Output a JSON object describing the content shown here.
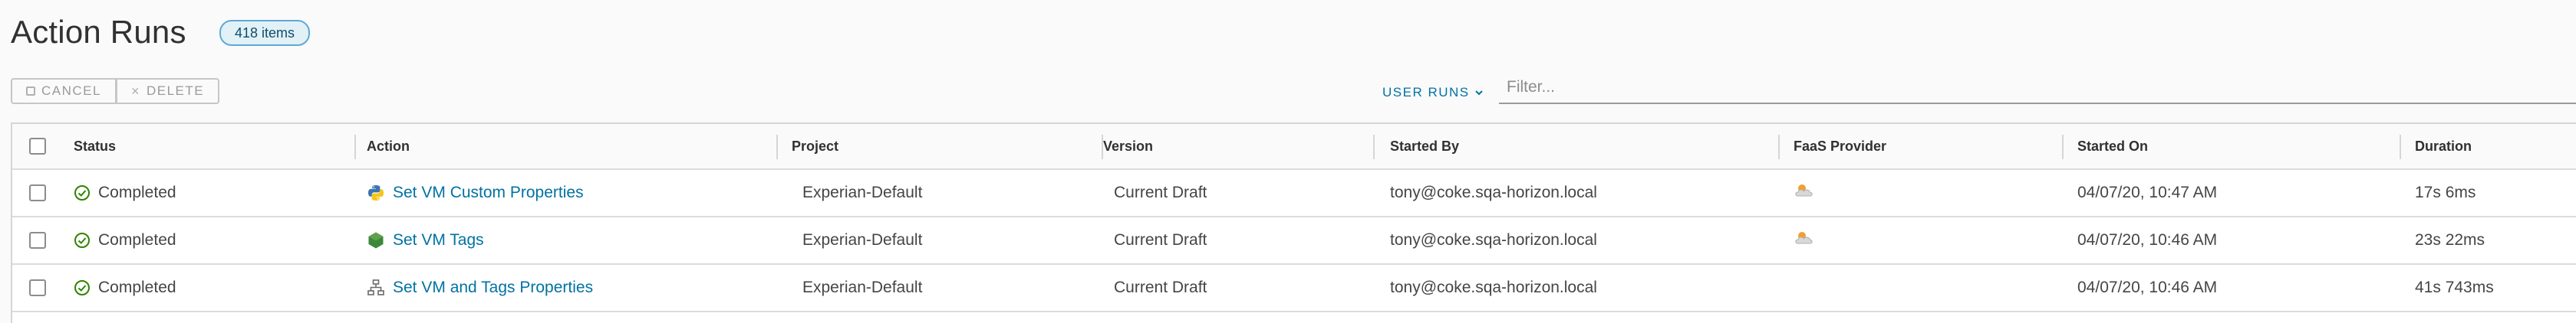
{
  "header": {
    "title": "Action Runs",
    "count_badge": "418 items"
  },
  "toolbar": {
    "cancel_label": "CANCEL",
    "delete_label": "DELETE",
    "user_runs_label": "USER RUNS",
    "filter_placeholder": "Filter..."
  },
  "table": {
    "columns": [
      "Status",
      "Action",
      "Project",
      "Version",
      "Started By",
      "FaaS Provider",
      "Started On",
      "Duration"
    ],
    "rows": [
      {
        "status": "Completed",
        "action": "Set VM Custom Properties",
        "action_icon": "python-icon",
        "project": "Experian-Default",
        "version": "Current Draft",
        "started_by": "tony@coke.sqa-horizon.local",
        "faas_provider_icon": "cloud-icon",
        "started_on": "04/07/20, 10:47 AM",
        "duration": "17s 6ms"
      },
      {
        "status": "Completed",
        "action": "Set VM Tags",
        "action_icon": "nodejs-icon",
        "project": "Experian-Default",
        "version": "Current Draft",
        "started_by": "tony@coke.sqa-horizon.local",
        "faas_provider_icon": "cloud-icon",
        "started_on": "04/07/20, 10:46 AM",
        "duration": "23s 22ms"
      },
      {
        "status": "Completed",
        "action": "Set VM and Tags Properties",
        "action_icon": "flow-icon",
        "project": "Experian-Default",
        "version": "Current Draft",
        "started_by": "tony@coke.sqa-horizon.local",
        "faas_provider_icon": "",
        "started_on": "04/07/20, 10:46 AM",
        "duration": "41s 743ms"
      }
    ]
  },
  "colors": {
    "link": "#0072a3",
    "success": "#2f8400",
    "badge_bg": "#e1f1f6",
    "badge_border": "#5fa9d4"
  }
}
